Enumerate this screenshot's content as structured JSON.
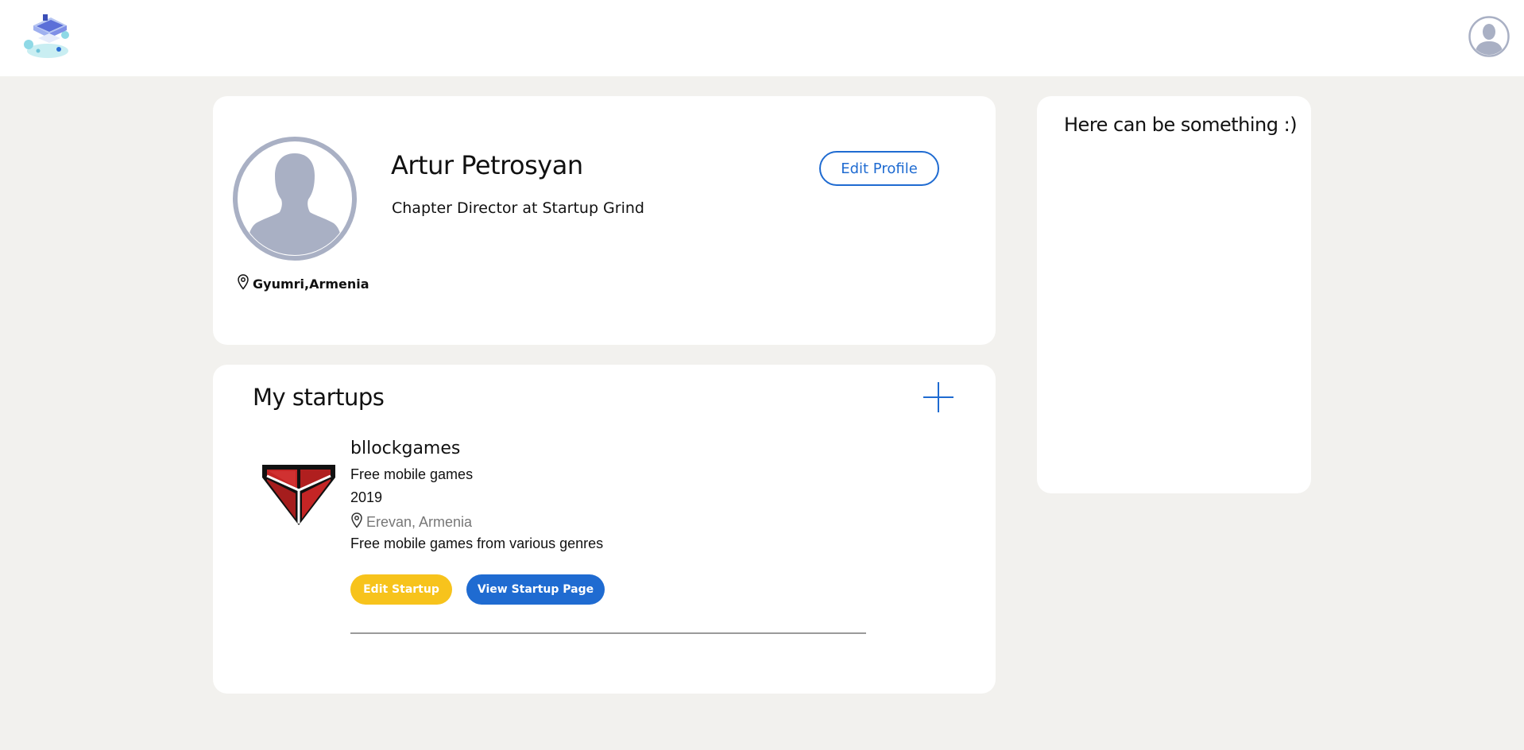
{
  "header": {
    "logo_icon": "laptop-isometric-logo-icon",
    "user_avatar_icon": "user-avatar-icon"
  },
  "profile": {
    "avatar_icon": "person-silhouette-icon",
    "name": "Artur Petrosyan",
    "title": "Chapter Director at Startup Grind",
    "location": "Gyumri,Armenia",
    "location_icon": "map-pin-icon",
    "edit_label": "Edit Profile"
  },
  "startups": {
    "heading": "My startups",
    "add_icon": "plus-icon",
    "items": [
      {
        "name": "bllockgames",
        "logo_icon": "red-hexagon-logo-icon",
        "tagline": "Free mobile games",
        "year": "2019",
        "location": "Erevan, Armenia",
        "location_icon": "map-pin-icon",
        "description": "Free mobile games from various genres",
        "edit_label": "Edit Startup",
        "view_label": "View Startup Page"
      }
    ]
  },
  "sidebar": {
    "title": "Here can be something :)"
  },
  "colors": {
    "accent_blue": "#1f6bd1",
    "accent_yellow": "#f7c31c",
    "background": "#f2f1ee",
    "avatar_gray": "#a9b0c4"
  }
}
